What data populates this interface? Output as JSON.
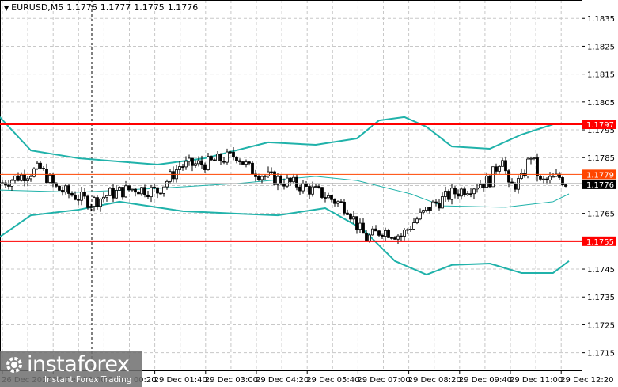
{
  "header": {
    "symbol": "EURUSD,M5",
    "ohlc": [
      "1.1776",
      "1.1777",
      "1.1775",
      "1.1776"
    ]
  },
  "logo": {
    "brand": "instaforex",
    "tagline": "Instant Forex Trading"
  },
  "colors": {
    "level_line": "#ff0000",
    "bollinger": "#20b2aa",
    "ask_line": "#ff4500",
    "bid_line": "#aaaaaa",
    "bull_candle": "#ffffff",
    "bear_candle": "#000000"
  },
  "chart_data": {
    "type": "candlestick",
    "timeframe": "M5",
    "y_ticks": [
      "1.1835",
      "1.1825",
      "1.1815",
      "1.1805",
      "1.1795",
      "1.1785",
      "1.1775",
      "1.1765",
      "1.1755",
      "1.1745",
      "1.1735",
      "1.1725",
      "1.1715"
    ],
    "ylim": [
      1.1711,
      1.1841
    ],
    "x_ticks": [
      "26 Dec 2025",
      "26 Dec 23:00",
      "29 Dec 00:20",
      "29 Dec 01:40",
      "29 Dec 03:00",
      "29 Dec 04:20",
      "29 Dec 05:40",
      "29 Dec 07:00",
      "29 Dec 08:20",
      "29 Dec 09:40",
      "29 Dec 11:00",
      "29 Dec 12:20"
    ],
    "grid": true,
    "levels": [
      {
        "price": 1.1797,
        "label": "1.1797"
      },
      {
        "price": 1.1755,
        "label": "1.1755"
      }
    ],
    "ask": {
      "price": 1.1779,
      "label": "1.1779"
    },
    "bid": {
      "price": 1.1776,
      "label": "1.1776"
    },
    "close_path": [
      [
        "26 Dec 21:40",
        1.1776
      ],
      [
        "26 Dec 22:40",
        1.1781
      ],
      [
        "26 Dec 23:05",
        1.1774
      ],
      [
        "29 Dec 00:00",
        1.1769
      ],
      [
        "29 Dec 00:30",
        1.1772
      ],
      [
        "29 Dec 01:10",
        1.1774
      ],
      [
        "29 Dec 01:45",
        1.1773
      ],
      [
        "29 Dec 02:05",
        1.1778
      ],
      [
        "29 Dec 02:20",
        1.1782
      ],
      [
        "29 Dec 03:05",
        1.1783
      ],
      [
        "29 Dec 03:35",
        1.1785
      ],
      [
        "29 Dec 03:50",
        1.1786
      ],
      [
        "29 Dec 04:10",
        1.1781
      ],
      [
        "29 Dec 04:40",
        1.1778
      ],
      [
        "29 Dec 05:30",
        1.1775
      ],
      [
        "29 Dec 06:05",
        1.1772
      ],
      [
        "29 Dec 06:45",
        1.1767
      ],
      [
        "29 Dec 07:05",
        1.1759
      ],
      [
        "29 Dec 07:15",
        1.1756
      ],
      [
        "29 Dec 07:40",
        1.1759
      ],
      [
        "29 Dec 08:10",
        1.1757
      ],
      [
        "29 Dec 08:35",
        1.1763
      ],
      [
        "29 Dec 09:00",
        1.1768
      ],
      [
        "29 Dec 09:30",
        1.1772
      ],
      [
        "29 Dec 10:05",
        1.1775
      ],
      [
        "29 Dec 10:30",
        1.1777
      ],
      [
        "29 Dec 10:50",
        1.1786
      ],
      [
        "29 Dec 11:00",
        1.1774
      ],
      [
        "29 Dec 11:20",
        1.1777
      ],
      [
        "29 Dec 11:35",
        1.1786
      ],
      [
        "29 Dec 11:50",
        1.1776
      ],
      [
        "29 Dec 12:20",
        1.1778
      ],
      [
        "29 Dec 12:30",
        1.1776
      ]
    ],
    "bollinger": {
      "upper": [
        [
          "26 Dec 21:35",
          1.17998
        ],
        [
          "26 Dec 22:25",
          1.17876
        ],
        [
          "26 Dec 23:40",
          1.17848
        ],
        [
          "29 Dec 01:45",
          1.17825
        ],
        [
          "29 Dec 03:00",
          1.17848
        ],
        [
          "29 Dec 04:40",
          1.17905
        ],
        [
          "29 Dec 05:55",
          1.17896
        ],
        [
          "29 Dec 07:00",
          1.17919
        ],
        [
          "29 Dec 07:35",
          1.17984
        ],
        [
          "29 Dec 08:15",
          1.17996
        ],
        [
          "29 Dec 08:50",
          1.17961
        ],
        [
          "29 Dec 09:30",
          1.1789
        ],
        [
          "29 Dec 10:30",
          1.17882
        ],
        [
          "29 Dec 11:20",
          1.17933
        ],
        [
          "29 Dec 12:10",
          1.1797
        ],
        [
          "29 Dec 12:35",
          1.1797
        ]
      ],
      "middle": [
        [
          "26 Dec 21:35",
          1.17734
        ],
        [
          "26 Dec 23:40",
          1.17726
        ],
        [
          "29 Dec 01:45",
          1.1774
        ],
        [
          "29 Dec 03:50",
          1.17757
        ],
        [
          "29 Dec 05:55",
          1.17783
        ],
        [
          "29 Dec 07:00",
          1.17768
        ],
        [
          "29 Dec 08:25",
          1.1772
        ],
        [
          "29 Dec 09:15",
          1.17677
        ],
        [
          "29 Dec 10:55",
          1.17672
        ],
        [
          "29 Dec 12:10",
          1.17692
        ],
        [
          "29 Dec 12:35",
          1.1772
        ]
      ],
      "lower": [
        [
          "26 Dec 21:35",
          1.17564
        ],
        [
          "26 Dec 22:25",
          1.17643
        ],
        [
          "26 Dec 23:40",
          1.17663
        ],
        [
          "29 Dec 00:45",
          1.17692
        ],
        [
          "29 Dec 02:25",
          1.17658
        ],
        [
          "29 Dec 03:50",
          1.17649
        ],
        [
          "29 Dec 04:55",
          1.17643
        ],
        [
          "29 Dec 06:10",
          1.17669
        ],
        [
          "29 Dec 07:10",
          1.17592
        ],
        [
          "29 Dec 08:00",
          1.17479
        ],
        [
          "29 Dec 08:50",
          1.1743
        ],
        [
          "29 Dec 09:30",
          1.17465
        ],
        [
          "29 Dec 10:30",
          1.1747
        ],
        [
          "29 Dec 11:20",
          1.17436
        ],
        [
          "29 Dec 12:10",
          1.17436
        ],
        [
          "29 Dec 12:35",
          1.17479
        ]
      ]
    }
  }
}
